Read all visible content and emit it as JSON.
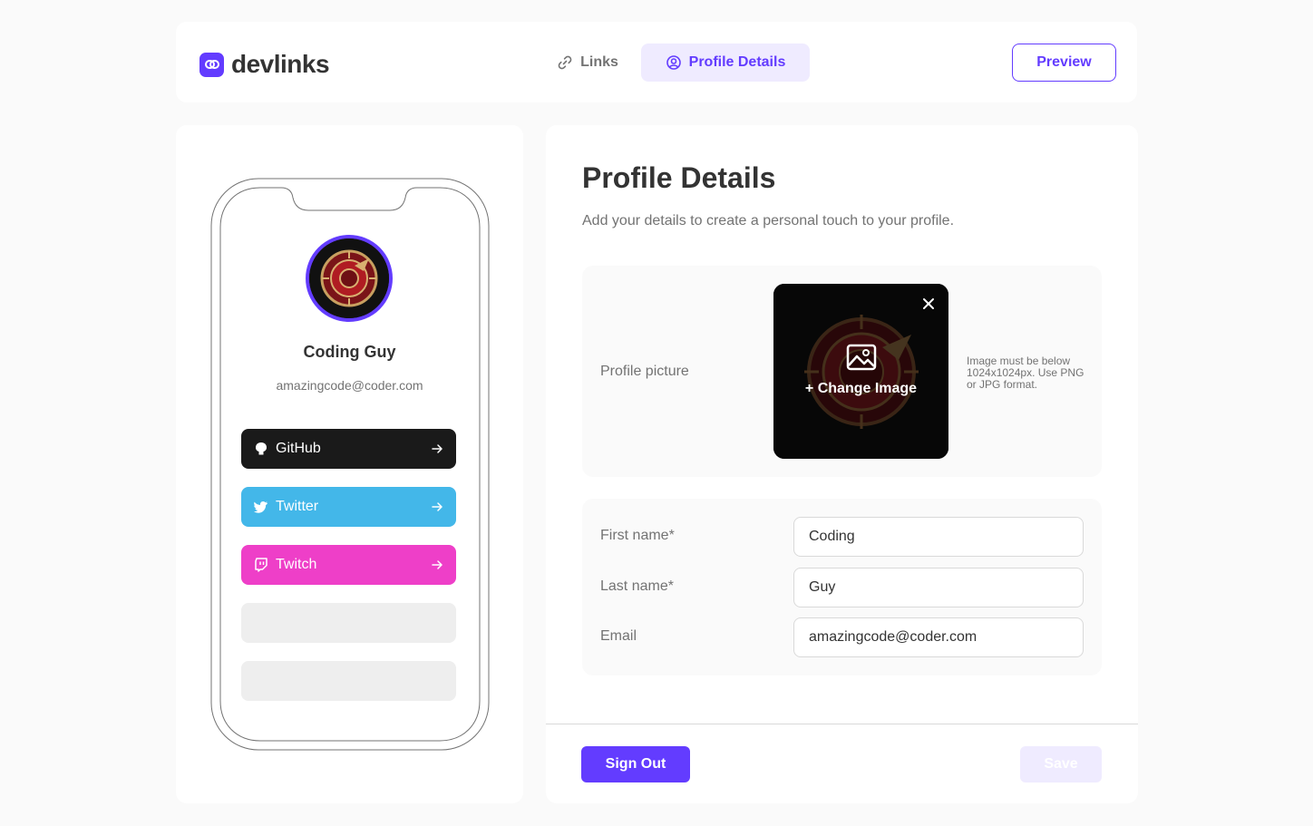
{
  "app": {
    "name": "devlinks",
    "accent_color": "#633cff"
  },
  "nav": {
    "tabs": [
      {
        "label": "Links",
        "icon": "link-icon",
        "active": false
      },
      {
        "label": "Profile Details",
        "icon": "user-circle-icon",
        "active": true
      }
    ],
    "preview_label": "Preview"
  },
  "preview": {
    "name": "Coding Guy",
    "email": "amazingcode@coder.com",
    "links": [
      {
        "platform": "GitHub",
        "icon": "github-icon",
        "color": "#1a1a1a"
      },
      {
        "platform": "Twitter",
        "icon": "twitter-icon",
        "color": "#43b7e9"
      },
      {
        "platform": "Twitch",
        "icon": "twitch-icon",
        "color": "#ee3fc8"
      }
    ],
    "empty_slots": 2
  },
  "profile": {
    "title": "Profile Details",
    "subtitle": "Add your details to create a personal touch to your profile.",
    "picture_label": "Profile picture",
    "change_image_label": "+ Change Image",
    "picture_hint": "Image must be below 1024x1024px. Use PNG or JPG format.",
    "fields": {
      "first_name": {
        "label": "First name*",
        "value": "Coding"
      },
      "last_name": {
        "label": "Last name*",
        "value": "Guy"
      },
      "email": {
        "label": "Email",
        "value": "amazingcode@coder.com"
      }
    }
  },
  "footer": {
    "signout_label": "Sign Out",
    "save_label": "Save"
  }
}
